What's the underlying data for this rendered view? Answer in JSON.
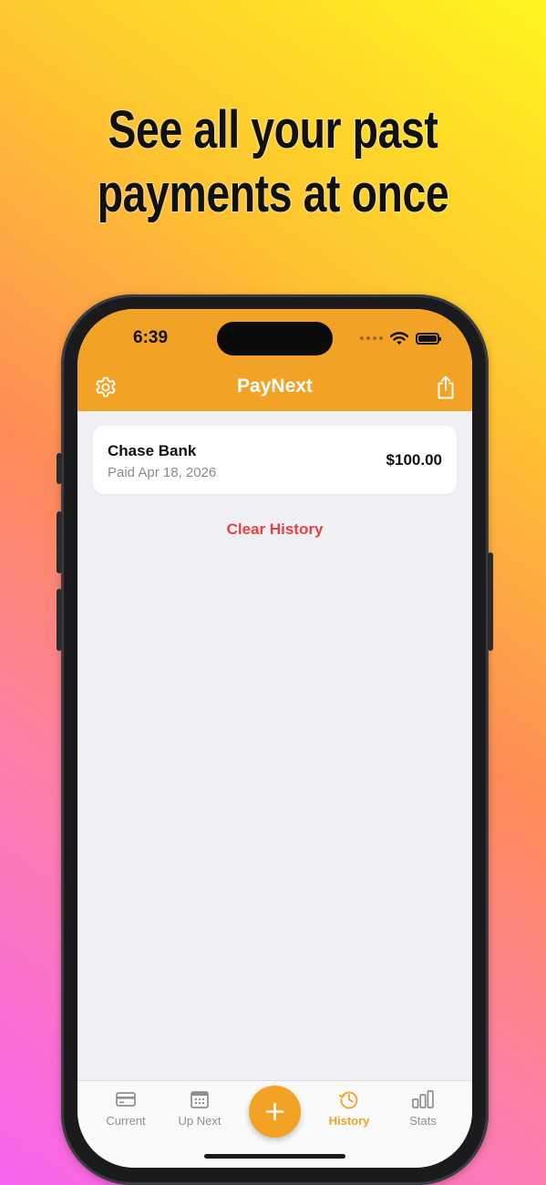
{
  "headline": {
    "line1": "See all your past",
    "line2": "payments at once"
  },
  "status_bar": {
    "time": "6:39"
  },
  "navbar": {
    "title": "PayNext",
    "left_icon": "gear-icon",
    "right_icon": "share-icon"
  },
  "history": {
    "items": [
      {
        "name": "Chase Bank",
        "subtitle": "Paid Apr 18, 2026",
        "amount": "$100.00"
      }
    ],
    "clear_label": "Clear History"
  },
  "tabbar": {
    "tabs": [
      {
        "label": "Current",
        "icon": "credit-card-icon"
      },
      {
        "label": "Up Next",
        "icon": "calendar-icon"
      },
      {
        "label": "History",
        "icon": "history-clock-icon"
      },
      {
        "label": "Stats",
        "icon": "bar-chart-icon"
      }
    ],
    "add_icon": "plus-icon",
    "active": "History"
  },
  "colors": {
    "accent": "#f2a326",
    "destructive": "#e8423d",
    "background": "#efeff4"
  }
}
